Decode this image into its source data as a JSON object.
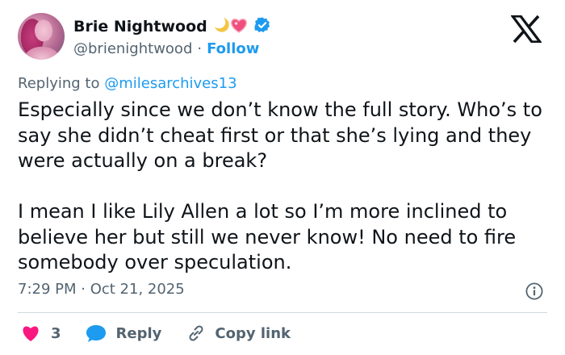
{
  "author": {
    "name": "Brie Nightwood",
    "emoji": "🌙💗",
    "handle": "@brienightwood",
    "separator": "·",
    "follow_label": "Follow"
  },
  "reply_context": {
    "prefix": "Replying to ",
    "mention": "@milesarchives13"
  },
  "tweet": {
    "text": "Especially since we don’t know the full story. Who’s to say she didn’t cheat first or that she’s lying and they were actually on a break?\n\nI mean I like Lily Allen a lot so I’m more inclined to believe her but still we never know! No need to fire somebody over speculation.",
    "timestamp": "7:29 PM · Oct 21, 2025"
  },
  "actions": {
    "like_count": "3",
    "reply_label": "Reply",
    "copy_label": "Copy link"
  },
  "colors": {
    "accent": "#1d9bf0",
    "like": "#f91880",
    "muted": "#536471",
    "text": "#0f1419"
  },
  "icons": [
    "avatar-image",
    "moon-icon",
    "heart-icon",
    "verified-badge-icon",
    "x-logo-icon",
    "info-icon",
    "like-heart-icon",
    "reply-bubble-icon",
    "link-icon"
  ]
}
